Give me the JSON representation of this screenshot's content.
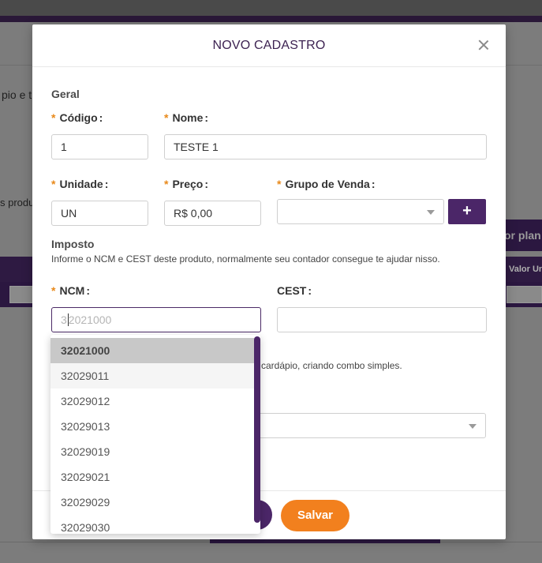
{
  "background": {
    "text_top": "pio e t",
    "text_mid": "s produ",
    "button_right": "or plan",
    "table_header_right": "Valor Un"
  },
  "modal": {
    "title": "NOVO CADASTRO",
    "section_geral": "Geral",
    "codigo": {
      "label": "Código",
      "value": "1"
    },
    "nome": {
      "label": "Nome",
      "value": "TESTE 1"
    },
    "unidade": {
      "label": "Unidade",
      "value": "UN"
    },
    "preco": {
      "label": "Preço",
      "value": "R$ 0,00"
    },
    "grupo_venda": {
      "label": "Grupo de Venda",
      "value": "",
      "add_label": "+"
    },
    "section_imposto": "Imposto",
    "imposto_desc": "Informe o NCM e CEST deste produto, normalmente seu contador consegue te ajudar nisso.",
    "ncm": {
      "label": "NCM",
      "typed": "3",
      "placeholder_rest": "2021000"
    },
    "cest": {
      "label": "CEST",
      "value": ""
    },
    "combo_desc_partial": "u cardápio, criando combo simples.",
    "save_label": "Salvar",
    "required_mark": "*",
    "colon": ":"
  },
  "ncm_dropdown": {
    "options": [
      "32021000",
      "32029011",
      "32029012",
      "32029013",
      "32029019",
      "32029021",
      "32029029",
      "32029030"
    ],
    "selected_index": 0,
    "hover_index": 1
  },
  "colors": {
    "brand_purple": "#4b2668",
    "accent_orange": "#f2801e",
    "required_orange": "#e8891a"
  }
}
